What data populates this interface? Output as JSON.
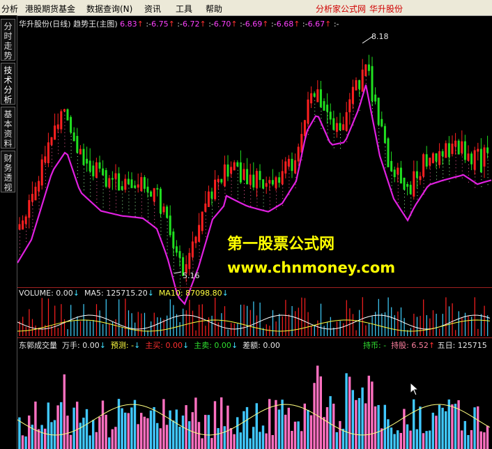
{
  "menu": {
    "items": [
      "分析",
      "港股期货基金",
      "数据查询(N)",
      "资讯",
      "工具",
      "帮助"
    ],
    "brand_left": "分析家公式网",
    "brand_right": "华升股份"
  },
  "left_tabs": [
    "分时走势",
    "技术分析",
    "基本资料",
    "财务透视"
  ],
  "main_header": {
    "title": "华升股份(日线) 趋势王(主图)",
    "values": [
      "6.83",
      ":-",
      "6.75",
      ":-",
      "6.72",
      ":-",
      "6.70",
      ":-",
      "6.69",
      ":-",
      "6.68",
      ":-",
      "6.67",
      ":-"
    ]
  },
  "price_labels": {
    "high": "8.18",
    "low": "5.16"
  },
  "watermark": {
    "line1": "第一股票公式网",
    "line2": "www.chnmoney.com"
  },
  "volume_header": {
    "volume": "VOLUME: 0.00",
    "ma5": "MA5: 125715.20",
    "ma10": "MA10: 87098.80"
  },
  "bottom_header": {
    "name": "东郭成交量",
    "wanshou": "万手: 0.00",
    "yuce": "预测: -",
    "zhumai": "主买: 0.00",
    "zhumai2": "主卖: 0.00",
    "chae": "差额: 0.00",
    "chibi": "持币: -",
    "chigu": "持股: 6.52",
    "wuri": "五日: 125715"
  },
  "colors": {
    "up": "#ff2020",
    "down": "#20e020",
    "trend": "#e020e0",
    "green_line": "#20e020",
    "watermark": "#ffff00"
  }
}
